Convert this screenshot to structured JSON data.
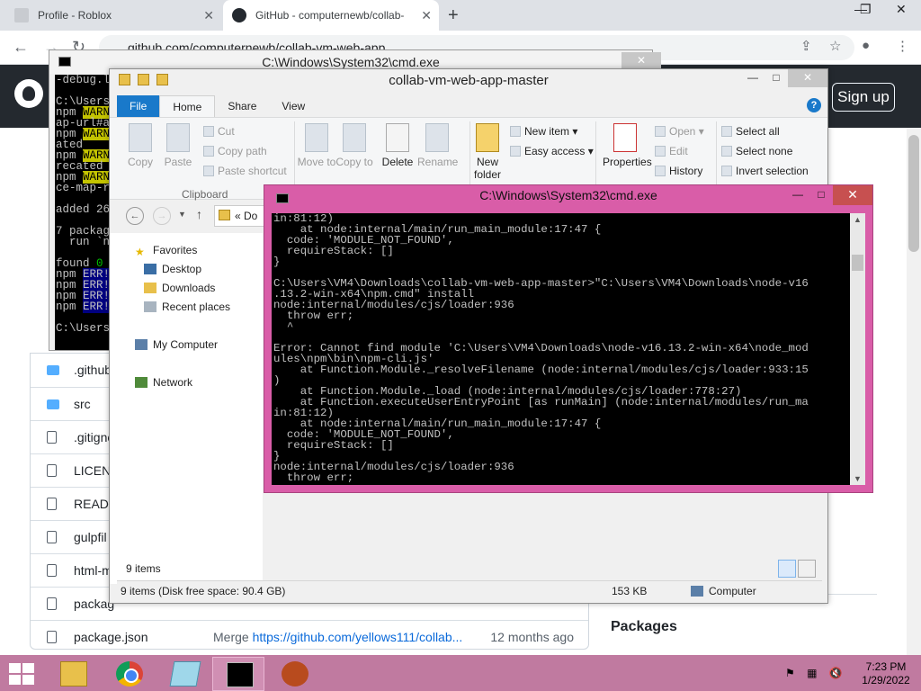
{
  "browser": {
    "tabs": [
      {
        "title": "Profile - Roblox"
      },
      {
        "title": "GitHub - computernewb/collab-"
      }
    ],
    "new_tab": "+",
    "window_controls": {
      "minimize": "—",
      "maximize": "❐",
      "close": "✕"
    },
    "address": "github.com/computernewb/collab-vm-web-app",
    "nav": {
      "back": "←",
      "forward": "→",
      "reload": "↻"
    },
    "signup_label": "Sign up"
  },
  "github": {
    "files": [
      {
        "name": ".github",
        "type": "folder",
        "message": "",
        "link": "",
        "time": ""
      },
      {
        "name": "src",
        "type": "folder",
        "message": "",
        "link": "",
        "time": ""
      },
      {
        "name": ".gitigno",
        "type": "file",
        "message": "",
        "link": "",
        "time": ""
      },
      {
        "name": "LICENS",
        "type": "file",
        "message": "",
        "link": "",
        "time": ""
      },
      {
        "name": "READM",
        "type": "file",
        "message": "",
        "link": "",
        "time": ""
      },
      {
        "name": "gulpfil",
        "type": "file",
        "message": "",
        "link": "",
        "time": ""
      },
      {
        "name": "html-m",
        "type": "file",
        "message": "",
        "link": "",
        "time": ""
      },
      {
        "name": "packag",
        "type": "file",
        "message": "",
        "link": "",
        "time": ""
      },
      {
        "name": "package.json",
        "type": "file",
        "message": "Merge ",
        "link": "https://github.com/yellows111/collab...",
        "time": "12 months ago"
      }
    ],
    "packages_heading": "Packages"
  },
  "cmd_back": {
    "title": "C:\\Windows\\System32\\cmd.exe",
    "close": "✕",
    "lines": [
      {
        "t": "-debug.l"
      },
      {
        "t": ""
      },
      {
        "t": "C:\\Users"
      },
      {
        "t": "npm ",
        "h": "WARN",
        "c": "y"
      },
      {
        "t": "ap-url#a"
      },
      {
        "t": "npm ",
        "h": "WARN",
        "c": "y"
      },
      {
        "t": "ated"
      },
      {
        "t": "npm ",
        "h": "WARN",
        "c": "y"
      },
      {
        "t": "recated"
      },
      {
        "t": "npm ",
        "h": "WARN",
        "c": "y"
      },
      {
        "t": "ce-map-r"
      },
      {
        "t": ""
      },
      {
        "t": "added 26"
      },
      {
        "t": ""
      },
      {
        "t": "7 packag"
      },
      {
        "t": "  run `n"
      },
      {
        "t": ""
      },
      {
        "t": "found ",
        "h": "0",
        "c": "g"
      },
      {
        "t": "npm ",
        "h": "ERR!",
        "c": "b"
      },
      {
        "t": "npm ",
        "h": "ERR!",
        "c": "b"
      },
      {
        "t": "npm ",
        "h": "ERR!",
        "c": "b"
      },
      {
        "t": "npm ",
        "h": "ERR!",
        "c": "b"
      },
      {
        "t": ""
      },
      {
        "t": "C:\\Users"
      }
    ]
  },
  "explorer": {
    "title": "collab-vm-web-app-master",
    "controls": {
      "minimize": "—",
      "maximize": "□",
      "close": "✕"
    },
    "tabs": [
      "File",
      "Home",
      "Share",
      "View"
    ],
    "help": "?",
    "clipboard": {
      "copy": "Copy",
      "paste": "Paste",
      "cut": "Cut",
      "copy_path": "Copy path",
      "paste_shortcut": "Paste shortcut",
      "group": "Clipboard"
    },
    "organize": {
      "move_to": "Move to",
      "copy_to": "Copy to",
      "delete": "Delete",
      "rename": "Rename"
    },
    "new": {
      "new_folder": "New folder",
      "new_item": "New item",
      "easy_access": "Easy access"
    },
    "open": {
      "properties": "Properties",
      "open": "Open",
      "edit": "Edit",
      "history": "History"
    },
    "select": {
      "select_all": "Select all",
      "select_none": "Select none",
      "invert": "Invert selection"
    },
    "address_text": "« Do",
    "nav_pane": {
      "favorites": "Favorites",
      "desktop": "Desktop",
      "downloads": "Downloads",
      "recent": "Recent places",
      "computer": "My Computer",
      "network": "Network"
    },
    "item_count": "9 items",
    "status_left": "9 items (Disk free space: 90.4 GB)",
    "status_size": "153 KB",
    "status_location": "Computer"
  },
  "cmd_front": {
    "title": "C:\\Windows\\System32\\cmd.exe",
    "controls": {
      "minimize": "—",
      "maximize": "□",
      "close": "✕"
    },
    "lines": [
      "in:81:12)",
      "    at node:internal/main/run_main_module:17:47 {",
      "  code: 'MODULE_NOT_FOUND',",
      "  requireStack: []",
      "}",
      "",
      "C:\\Users\\VM4\\Downloads\\collab-vm-web-app-master>\"C:\\Users\\VM4\\Downloads\\node-v16",
      ".13.2-win-x64\\npm.cmd\" install",
      "node:internal/modules/cjs/loader:936",
      "  throw err;",
      "  ^",
      "",
      "Error: Cannot find module 'C:\\Users\\VM4\\Downloads\\node-v16.13.2-win-x64\\node_mod",
      "ules\\npm\\bin\\npm-cli.js'",
      "    at Function.Module._resolveFilename (node:internal/modules/cjs/loader:933:15",
      ")",
      "    at Function.Module._load (node:internal/modules/cjs/loader:778:27)",
      "    at Function.executeUserEntryPoint [as runMain] (node:internal/modules/run_ma",
      "in:81:12)",
      "    at node:internal/main/run_main_module:17:47 {",
      "  code: 'MODULE_NOT_FOUND',",
      "  requireStack: []",
      "}",
      "node:internal/modules/cjs/loader:936",
      "  throw err;"
    ]
  },
  "taskbar": {
    "items": [
      "File Explorer",
      "Google Chrome",
      "Notes",
      "Command Prompt",
      "App"
    ],
    "clock_time": "7:23 PM",
    "clock_date": "1/29/2022"
  },
  "colors": {
    "taskbar": "#c07aa0",
    "cmd_frame": "#d95da8",
    "github_header": "#24292f",
    "ribbon_file_tab": "#1979ca"
  }
}
